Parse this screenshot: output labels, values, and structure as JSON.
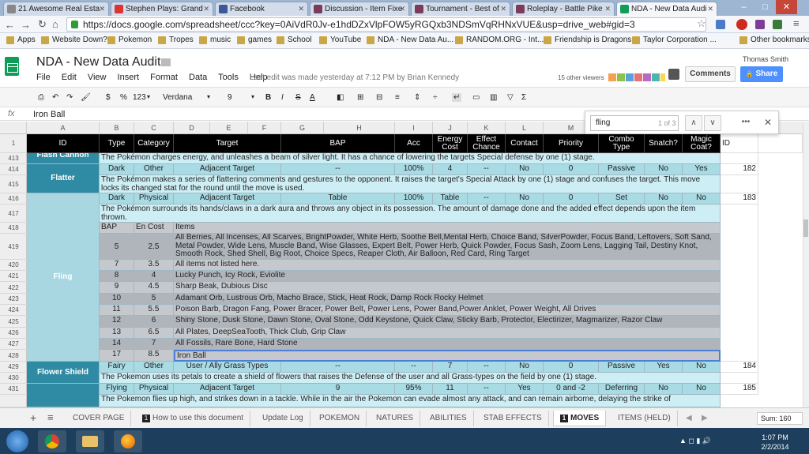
{
  "browser": {
    "tabs": [
      {
        "label": "21 Awesome Real Esta"
      },
      {
        "label": "Stephen Plays: Grand"
      },
      {
        "label": "Facebook"
      },
      {
        "label": "Discussion - Item Fixe"
      },
      {
        "label": "Tournament - Best of"
      },
      {
        "label": "Roleplay - Battle Pike"
      },
      {
        "label": "NDA - New Data Audi"
      }
    ],
    "url": "https://docs.google.com/spreadsheet/ccc?key=0AiVdR0Jv-e1hdDZxVlpFOW5yRGQxb3NDSmVqRHNxVUE&usp=drive_web#gid=3",
    "bookmarks": [
      "Apps",
      "Website Down?",
      "Pokemon",
      "Tropes",
      "music",
      "games",
      "School",
      "YouTube",
      "NDA - New Data Au...",
      "RANDOM.ORG - Int...",
      "Friendship is Dragons",
      "Taylor Corporation ...",
      "Other bookmarks"
    ]
  },
  "doc": {
    "title": "NDA - New Data Audit",
    "menu": [
      "File",
      "Edit",
      "View",
      "Insert",
      "Format",
      "Data",
      "Tools",
      "Help"
    ],
    "last_edit": "Last edit was made yesterday at 7:12 PM by Brian Kennedy",
    "user": "Thomas Smith",
    "viewers": "15 other viewers",
    "viewer_colors": [
      "#f6a04d",
      "#8bc34a",
      "#5aa0e0",
      "#e57373",
      "#ba68c8",
      "#4db6ac",
      "#ffd54f"
    ],
    "comments_label": "Comments",
    "share_label": "Share"
  },
  "toolbar": {
    "currency": "$",
    "percent": "%",
    "number_format": "123",
    "font": "Verdana",
    "font_size": "9",
    "bold": "B",
    "italic": "I",
    "strike": "S",
    "text_color": "A",
    "sigma": "Σ"
  },
  "formula": {
    "fx": "fx",
    "value": "Iron Ball"
  },
  "find": {
    "query": "fling",
    "count": "1 of 3",
    "more": "•••",
    "close": "✕"
  },
  "columns": [
    "A",
    "B",
    "C",
    "D",
    "E",
    "F",
    "G",
    "H",
    "I",
    "J",
    "K",
    "L",
    "M",
    "N",
    "O",
    "P",
    "Q"
  ],
  "header": {
    "row": "1",
    "id": "ID",
    "type": "Type",
    "category": "Category",
    "target": "Target",
    "bap": "BAP",
    "acc": "Acc",
    "energy_cost": "Energy Cost",
    "effect_chance": "Effect Chance",
    "contact": "Contact",
    "priority": "Priority",
    "combo_type": "Combo Type",
    "snatch": "Snatch?",
    "magic_coat": "Magic Coat?",
    "id2": "ID"
  },
  "rows": {
    "r413": {
      "num": "413",
      "name": "Flash Cannon",
      "desc": "The Pokémon charges energy, and unleashes a beam of silver light. It has a chance of lowering the targets Special defense by one (1) stage."
    },
    "r414": {
      "num": "414",
      "name": "Flatter",
      "type": "Dark",
      "category": "Other",
      "target": "Adjacent Target",
      "bap": "--",
      "acc": "100%",
      "energy": "4",
      "effect": "--",
      "contact": "No",
      "priority": "0",
      "combo": "Passive",
      "snatch": "No",
      "magic": "Yes",
      "id": "182"
    },
    "r415": {
      "num": "415",
      "desc": "The Pokémon makes a series of flattering comments and gestures to the opponent. It raises the target's Special Attack by one (1) stage and confuses the target. This move locks its changed stat for the round until the move is used."
    },
    "r416": {
      "num": "416",
      "type": "Dark",
      "category": "Physical",
      "target": "Adjacent Target",
      "bap": "Table",
      "acc": "100%",
      "energy": "Table",
      "effect": "--",
      "contact": "No",
      "priority": "0",
      "combo": "Set",
      "snatch": "No",
      "magic": "No",
      "id": "183"
    },
    "r417": {
      "num": "417",
      "desc": "The Pokémon surrounds its hands/claws in a dark aura and throws any object in its possession. The amount of damage done and the added effect depends upon the item thrown."
    },
    "r418": {
      "num": "418",
      "name": "Fling",
      "bap": "BAP",
      "cost": "En Cost",
      "items": "Items"
    },
    "r419": {
      "num": "419",
      "bap": "5",
      "cost": "2.5",
      "items": "All Berries, All Incenses, All Scarves, BrightPowder, White Herb, Soothe Bell,Mental Herb, Choice Band, SilverPowder, Focus Band, Leftovers, Soft Sand, Metal Powder, Wide Lens, Muscle Band, Wise Glasses, Expert Belt, Power Herb, Quick Powder, Focus Sash, Zoom Lens, Lagging Tail, Destiny Knot, Smooth Rock, Shed Shell, Big Root, Choice Specs, Reaper Cloth, Air Balloon, Red Card, Ring Target"
    },
    "r420": {
      "num": "420",
      "bap": "7",
      "cost": "3.5",
      "items": "All items not listed here."
    },
    "r421": {
      "num": "421",
      "bap": "8",
      "cost": "4",
      "items": "Lucky Punch, Icy Rock, Eviolite"
    },
    "r422": {
      "num": "422",
      "bap": "9",
      "cost": "4.5",
      "items": "Sharp Beak, Dubious Disc"
    },
    "r423": {
      "num": "423",
      "bap": "10",
      "cost": "5",
      "items": "Adamant Orb, Lustrous Orb, Macho Brace, Stick, Heat Rock, Damp Rock Rocky Helmet"
    },
    "r424": {
      "num": "424",
      "bap": "11",
      "cost": "5.5",
      "items": "Poison Barb, Dragon Fang, Power Bracer, Power Belt, Power Lens, Power Band,Power Anklet, Power Weight, All Drives"
    },
    "r425": {
      "num": "425",
      "bap": "12",
      "cost": "6",
      "items": "Shiny Stone, Dusk Stone, Dawn Stone, Oval Stone, Odd Keystone, Quick Claw, Sticky Barb, Protector, Electirizer, Magmarizer, Razor Claw"
    },
    "r426": {
      "num": "426",
      "bap": "13",
      "cost": "6.5",
      "items": "All Plates, DeepSeaTooth, Thick Club, Grip Claw"
    },
    "r427": {
      "num": "427",
      "bap": "14",
      "cost": "7",
      "items": "All Fossils, Rare Bone, Hard Stone"
    },
    "r428": {
      "num": "428",
      "bap": "17",
      "cost": "8.5",
      "items": "Iron Ball"
    },
    "r429": {
      "num": "429",
      "name": "Flower Shield",
      "type": "Fairy",
      "category": "Other",
      "target": "User / Ally Grass Types",
      "bap": "--",
      "acc": "--",
      "energy": "7",
      "effect": "--",
      "contact": "No",
      "priority": "0",
      "combo": "Passive",
      "snatch": "Yes",
      "magic": "No",
      "id": "184"
    },
    "r430": {
      "num": "430",
      "desc": "The Pokemon uses its petals to create a shield of flowers that raises the Defense of the user and all Grass-types on the field by one (1) stage."
    },
    "r431": {
      "num": "431",
      "type": "Flying",
      "category": "Physical",
      "target": "Adjacent Target",
      "bap": "9",
      "acc": "95%",
      "energy": "11",
      "effect": "--",
      "contact": "Yes",
      "priority": "0 and -2",
      "combo": "Deferring",
      "snatch": "No",
      "magic": "No",
      "id": "185"
    },
    "r432": {
      "desc": "The Pokemon flies up high, and strikes down in a tackle. While in the air the Pokemon can evade almost any attack, and can remain airborne, delaying the strike of"
    }
  },
  "sheet_tabs": {
    "cover": "COVER PAGE",
    "howto_num": "1",
    "howto": "How to use this document",
    "update": "Update Log",
    "pokemon": "POKEMON",
    "natures": "NATURES",
    "abilities": "ABILITIES",
    "stab": "STAB EFFECTS",
    "moves_num": "1",
    "moves": "MOVES",
    "items": "ITEMS (HELD)"
  },
  "sum": "Sum: 160",
  "clock": {
    "time": "1:07 PM",
    "date": "2/2/2014"
  }
}
